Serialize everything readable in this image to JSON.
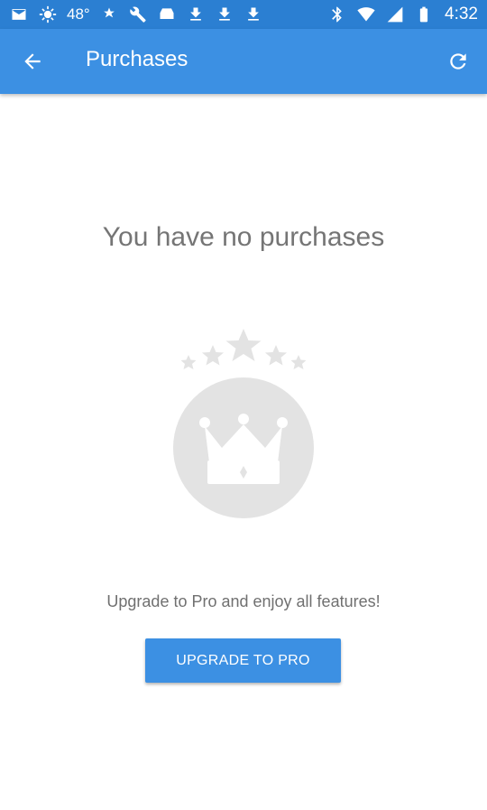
{
  "status_bar": {
    "temperature": "48°",
    "time": "4:32",
    "icons_left": [
      "mail-icon",
      "sun-icon",
      "weather-icon",
      "wrench-icon",
      "game-controller-icon",
      "download-icon",
      "download-icon",
      "download-icon"
    ],
    "icons_right": [
      "bluetooth-icon",
      "wifi-icon",
      "signal-icon",
      "battery-icon"
    ]
  },
  "app_bar": {
    "title": "Purchases",
    "back_icon": "arrow-back-icon",
    "refresh_icon": "refresh-icon"
  },
  "content": {
    "empty_title": "You have no purchases",
    "illustration": "crown-with-stars-icon",
    "subtitle": "Upgrade to Pro and enjoy all features!",
    "upgrade_button": "UPGRADE TO PRO"
  },
  "colors": {
    "status_bar": "#2b7fd2",
    "app_bar": "#3c90e3",
    "button": "#3c90e3",
    "illustration_gray": "#e0e0e0"
  }
}
